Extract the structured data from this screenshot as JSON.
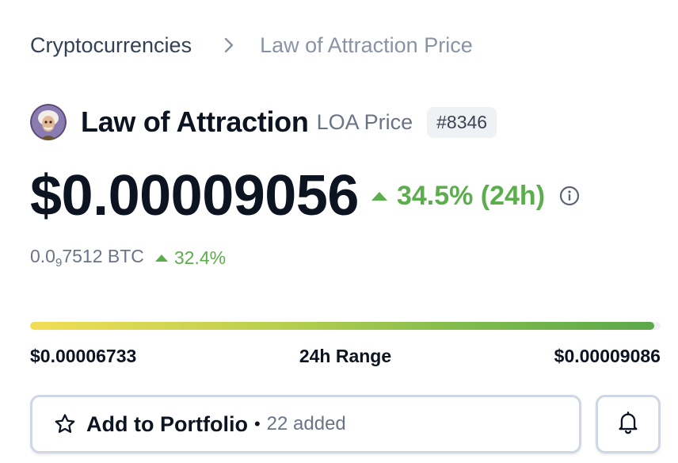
{
  "breadcrumb": {
    "root": "Cryptocurrencies",
    "current": "Law of Attraction Price"
  },
  "coin": {
    "name": "Law of Attraction",
    "symbol_label": "LOA Price",
    "rank": "#8346"
  },
  "price": {
    "value": "$0.00009056",
    "change_24h": "34.5% (24h)",
    "change_direction": "up"
  },
  "btc": {
    "prefix": "0.0",
    "zero_count": "9",
    "suffix": "7512 BTC",
    "change": "32.4%"
  },
  "range": {
    "low": "$0.00006733",
    "label": "24h Range",
    "high": "$0.00009086",
    "current_position_fraction": 0.99
  },
  "actions": {
    "portfolio_label": "Add to Portfolio",
    "separator": "•",
    "added_count": "22 added"
  },
  "icons": {
    "breadcrumb_separator": "chevron-right-icon",
    "price_info": "info-icon",
    "portfolio": "star-icon",
    "alert": "bell-icon"
  },
  "colors": {
    "positive": "#5bae4b",
    "text_primary": "#0d1421",
    "text_muted": "#6b7487",
    "border": "#cfd6e4"
  }
}
